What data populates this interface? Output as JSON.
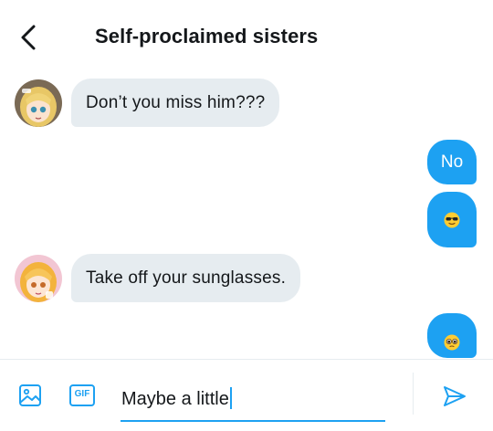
{
  "header": {
    "title": "Self-proclaimed sisters",
    "back_icon": "chevron-left-icon"
  },
  "messages": [
    {
      "direction": "incoming",
      "text": "Don’t you miss him???",
      "avatar": "anime-girl-avatar-1"
    },
    {
      "direction": "outgoing",
      "text": "No"
    },
    {
      "direction": "outgoing",
      "emoji": "sunglasses-face-emoji"
    },
    {
      "direction": "incoming",
      "text": "Take off your sunglasses.",
      "avatar": "anime-girl-avatar-2"
    },
    {
      "direction": "outgoing",
      "emoji": "pleading-face-emoji"
    }
  ],
  "composer": {
    "input_value": "Maybe a little",
    "media_icon": "image-icon",
    "gif_label": "GIF",
    "send_icon": "send-icon"
  },
  "colors": {
    "accent": "#1da1f2",
    "incoming_bubble": "#e6ecf0",
    "text": "#14171a"
  }
}
